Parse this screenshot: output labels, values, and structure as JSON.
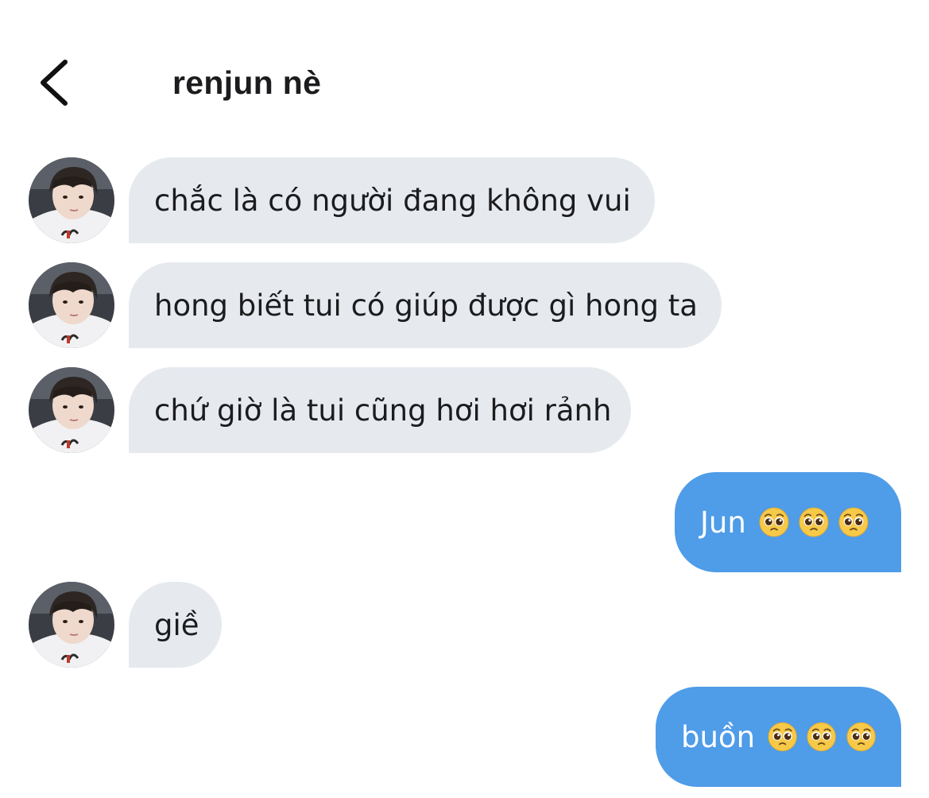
{
  "header": {
    "back_icon": "chevron-left-icon",
    "title": "renjun nè"
  },
  "messages": [
    {
      "direction": "incoming",
      "text": "chắc là có người đang không vui"
    },
    {
      "direction": "incoming",
      "text": "hong biết tui có giúp được gì hong ta"
    },
    {
      "direction": "incoming",
      "text": "chứ giờ là tui cũng hơi hơi rảnh"
    },
    {
      "direction": "outgoing",
      "text": "Jun",
      "emoji": [
        "pleading-face",
        "pleading-face",
        "pleading-face"
      ]
    },
    {
      "direction": "incoming",
      "text": "giề"
    },
    {
      "direction": "outgoing",
      "text": "buồn",
      "emoji": [
        "pleading-face",
        "pleading-face",
        "pleading-face"
      ]
    }
  ],
  "colors": {
    "incoming_bubble": "#e6eaef",
    "outgoing_bubble": "#4f9ce8",
    "text_dark": "#1c1c1e",
    "text_light": "#ffffff"
  }
}
